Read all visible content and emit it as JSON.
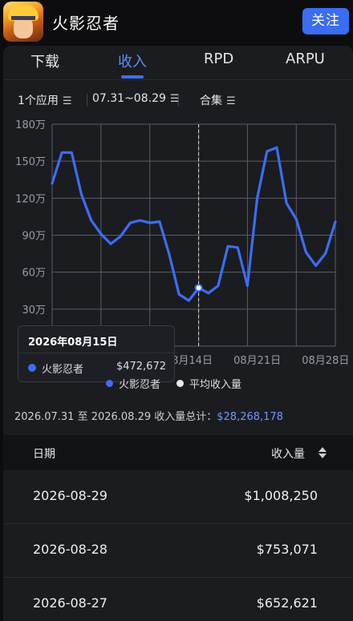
{
  "app": {
    "title": "火影忍者",
    "follow_label": "关注"
  },
  "tabs": [
    {
      "label": "下载",
      "active": false
    },
    {
      "label": "收入",
      "active": true
    },
    {
      "label": "RPD",
      "active": false
    },
    {
      "label": "ARPU",
      "active": false
    }
  ],
  "filters": {
    "apps": "1个应用",
    "date_range": "07.31~08.29",
    "group": "合集"
  },
  "chart_data": {
    "type": "line",
    "y_tick_labels": [
      "180万",
      "150万",
      "120万",
      "90万",
      "60万",
      "30万"
    ],
    "ylim": [
      0,
      1800000
    ],
    "x_tick_labels": [
      "08月14日",
      "08月21日",
      "08月28日"
    ],
    "grid": true,
    "legend_position": "bottom",
    "series": [
      {
        "name": "火影忍者",
        "color": "#3c6df2",
        "x": [
          "07-31",
          "08-01",
          "08-02",
          "08-03",
          "08-04",
          "08-05",
          "08-06",
          "08-07",
          "08-08",
          "08-09",
          "08-10",
          "08-11",
          "08-12",
          "08-13",
          "08-14",
          "08-15",
          "08-16",
          "08-17",
          "08-18",
          "08-19",
          "08-20",
          "08-21",
          "08-22",
          "08-23",
          "08-24",
          "08-25",
          "08-26",
          "08-27",
          "08-28",
          "08-29"
        ],
        "values": [
          1320000,
          1570000,
          1570000,
          1230000,
          1020000,
          910000,
          830000,
          890000,
          1000000,
          1020000,
          1000000,
          1010000,
          740000,
          420000,
          370000,
          472672,
          430000,
          490000,
          810000,
          800000,
          490000,
          1200000,
          1580000,
          1610000,
          1160000,
          1030000,
          760000,
          652621,
          753071,
          1008250
        ]
      },
      {
        "name": "平均收入量",
        "color": "#e8e8e8"
      }
    ],
    "tooltip": {
      "date": "2026年08月15日",
      "series": "火影忍者",
      "value": "$472,672"
    }
  },
  "summary": {
    "prefix": "2026.07.31 至 2026.08.29 收入量总计：",
    "total": "$28,268,178"
  },
  "table": {
    "col_date": "日期",
    "col_revenue": "收入量",
    "rows": [
      {
        "date": "2026-08-29",
        "revenue": "$1,008,250"
      },
      {
        "date": "2026-08-28",
        "revenue": "$753,071"
      },
      {
        "date": "2026-08-27",
        "revenue": "$652,621"
      }
    ]
  }
}
